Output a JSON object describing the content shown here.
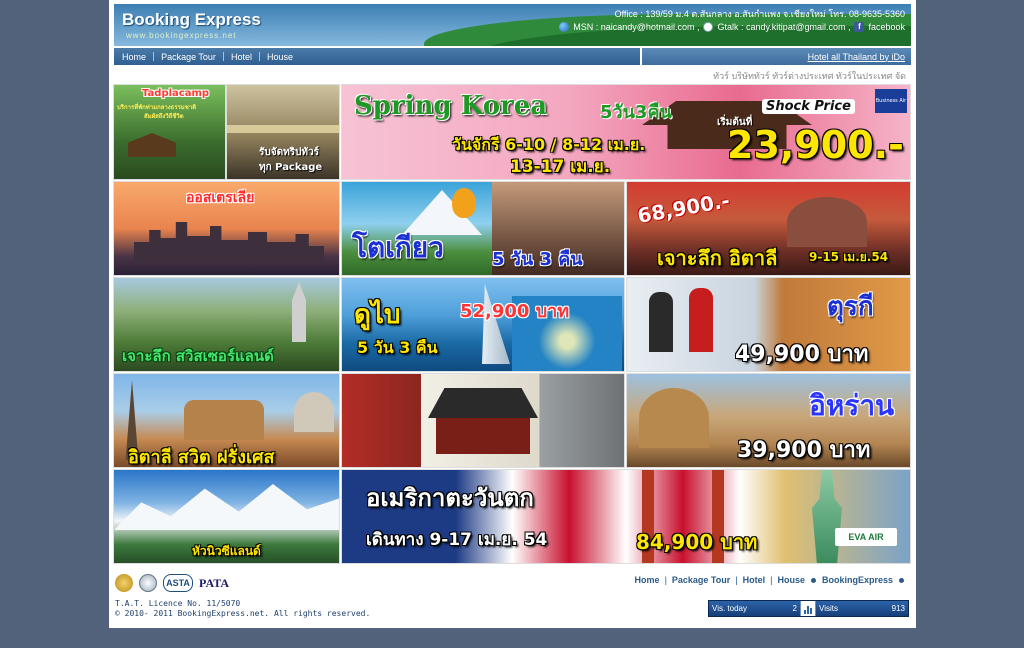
{
  "header": {
    "logo_title": "Booking Express",
    "logo_url": "www.bookingexpress.net",
    "office": "Office : 139/59 ม.4 ต.สันกลาง อ.สันกำแพง จ.เชียงใหม่  โทร. 08-9635-5360",
    "msn": "MSN : naicandy@hotmail.com ,",
    "gtalk": "Gtalk : candy.kitipat@gmail.com ,",
    "facebook": "facebook"
  },
  "nav": {
    "items": [
      "Home",
      "Package Tour",
      "Hotel",
      "House"
    ],
    "right_link": "Hotel all Thailand by iDo"
  },
  "marquee": "ทัวร์ บริษัททัวร์ ทัวร์ต่างประเทศ ทัวร์ในประเทศ จัด",
  "banners": {
    "tadplacamp": {
      "title": "Tadplacamp",
      "line1": "บริการที่พักท่ามกลางธรรมชาติ",
      "line2": "สัมผัสถึงวิถีชีวิต",
      "sub1": "รับจัดทริปทัวร์",
      "sub2": "ทุก Package"
    },
    "korea": {
      "title": "Spring Korea",
      "days": "5วัน3คืน",
      "shock": "Shock Price",
      "from": "เริ่มต้นที่",
      "dates1": "วันจักรี 6-10 / 8-12 เม.ย.",
      "dates2": "13-17 เม.ย.",
      "price": "23,900.-",
      "airline": "Business Air"
    },
    "australia": {
      "title": "ออสเตรเลีย"
    },
    "tokyo": {
      "title": "โตเกียว",
      "days": "5 วัน 3 คืน"
    },
    "italy": {
      "price": "68,900.-",
      "title": "เจาะลึก อิตาลี",
      "dates": "9-15 เม.ย.54"
    },
    "swiss": {
      "title": "เจาะลึก สวิสเซอร์แลนด์"
    },
    "dubai": {
      "title": "ดูไบ",
      "price": "52,900 บาท",
      "days": "5 วัน 3 คืน"
    },
    "turkey": {
      "title": "ตุรกี",
      "price": "49,900 บาท"
    },
    "europe": {
      "title": "อิตาลี สวิต ฝรั่งเศส"
    },
    "iran": {
      "title": "อิหร่าน",
      "price": "39,900 บาท"
    },
    "nz": {
      "title": "หัวนิวซีแลนด์"
    },
    "usa": {
      "title": "อเมริกาตะวันตก",
      "dates": "เดินทาง 9-17 เม.ย. 54",
      "price": "84,900 บาท",
      "airline": "EVA AIR"
    }
  },
  "footer": {
    "logos": [
      "TAT",
      "TTAA",
      "ASTA",
      "PATA"
    ],
    "nav": [
      "Home",
      "Package Tour",
      "Hotel",
      "House",
      "BookingExpress"
    ],
    "licence": "T.A.T. Licence No. 11/5070",
    "copyright": "© 2010- 2011 BookingExpress.net. All rights reserved.",
    "counter": {
      "visits_today_label": "Vis. today",
      "visits_today_value": "2",
      "visits_label": "Visits",
      "visits_value": "913"
    }
  }
}
